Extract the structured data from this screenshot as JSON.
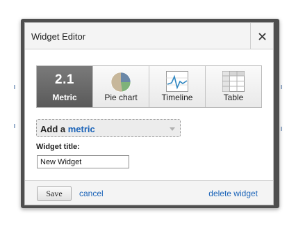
{
  "dialog": {
    "title": "Widget Editor",
    "close_icon": "close-icon"
  },
  "widget_types": [
    {
      "label": "Metric",
      "value_text": "2.1",
      "icon": "metric-number-icon",
      "selected": true
    },
    {
      "label": "Pie chart",
      "icon": "pie-chart-icon",
      "selected": false
    },
    {
      "label": "Timeline",
      "icon": "timeline-icon",
      "selected": false
    },
    {
      "label": "Table",
      "icon": "table-icon",
      "selected": false
    }
  ],
  "metric_dropdown": {
    "prefix": "Add a",
    "highlight": "metric"
  },
  "title_field": {
    "label": "Widget title:",
    "value": "New Widget"
  },
  "footer": {
    "save_label": "Save",
    "cancel_label": "cancel",
    "delete_label": "delete widget"
  },
  "colors": {
    "link": "#1a63b8",
    "selected_tab": "#6a6a6a",
    "pie_slice_1": "#c7b79b",
    "pie_slice_2": "#6b88a8",
    "pie_slice_3": "#7fb27a",
    "timeline_line": "#2e86c1"
  }
}
